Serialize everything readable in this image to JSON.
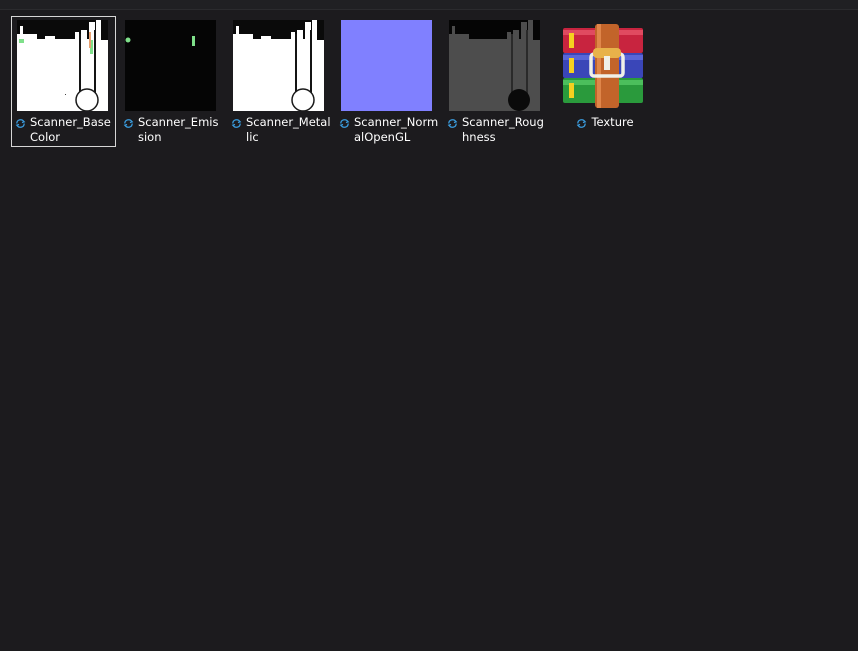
{
  "files": [
    {
      "name": "Scanner_BaseColor",
      "selected": true,
      "thumbnail": "basecolor-map",
      "status_icon": "sync-icon"
    },
    {
      "name": "Scanner_Emission",
      "selected": false,
      "thumbnail": "emission-map",
      "status_icon": "sync-icon"
    },
    {
      "name": "Scanner_Metallic",
      "selected": false,
      "thumbnail": "metallic-map",
      "status_icon": "sync-icon"
    },
    {
      "name": "Scanner_NormalOpenGL",
      "selected": false,
      "thumbnail": "normal-map",
      "status_icon": "sync-icon"
    },
    {
      "name": "Scanner_Roughness",
      "selected": false,
      "thumbnail": "roughness-map",
      "status_icon": "sync-icon"
    },
    {
      "name": "Texture",
      "selected": false,
      "thumbnail": "winrar-archive-icon",
      "status_icon": "sync-icon"
    }
  ],
  "colors": {
    "background": "#1c1b1e",
    "selection_border": "#d6d6d6",
    "sync_icon": "#3a9bdc",
    "normal_map": "#8080ff",
    "roughness_gray": "#4d4d4d",
    "emission_green": "#7fe08a"
  }
}
